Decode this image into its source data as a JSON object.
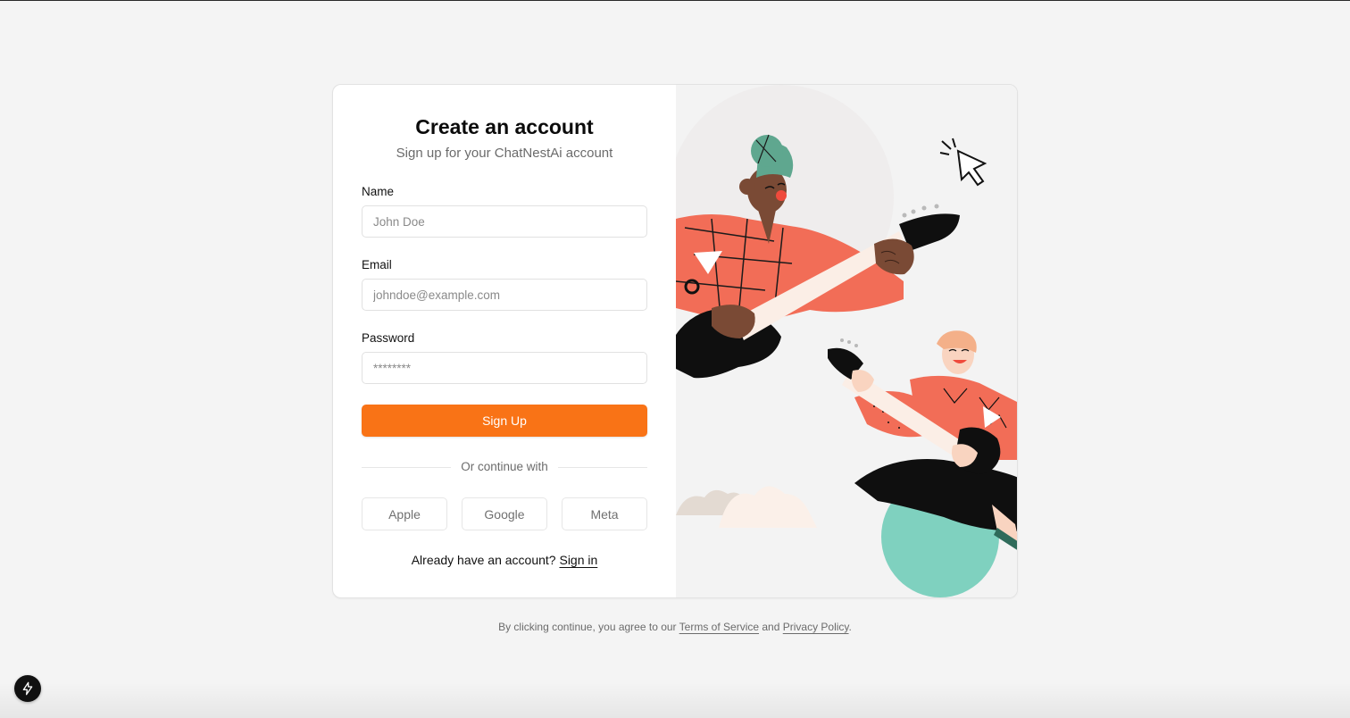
{
  "form": {
    "title": "Create an account",
    "subtitle": "Sign up for your ChatNestAi account",
    "name_label": "Name",
    "name_placeholder": "John Doe",
    "email_label": "Email",
    "email_placeholder": "johndoe@example.com",
    "password_label": "Password",
    "password_placeholder": "********",
    "submit_label": "Sign Up",
    "divider_text": "Or continue with",
    "social_buttons": [
      "Apple",
      "Google",
      "Meta"
    ],
    "signin_prompt": "Already have an account?",
    "signin_link": "Sign in"
  },
  "legal": {
    "prefix": "By clicking continue, you agree to our",
    "terms": "Terms of Service",
    "and": "and",
    "privacy": "Privacy Policy",
    "suffix": "."
  },
  "colors": {
    "accent": "#f97316",
    "illustration_coral": "#f26d57",
    "illustration_teal": "#7fd1bf"
  },
  "icons": {
    "floating_button": "bolt-icon",
    "illustration_cursor": "cursor-icon"
  }
}
